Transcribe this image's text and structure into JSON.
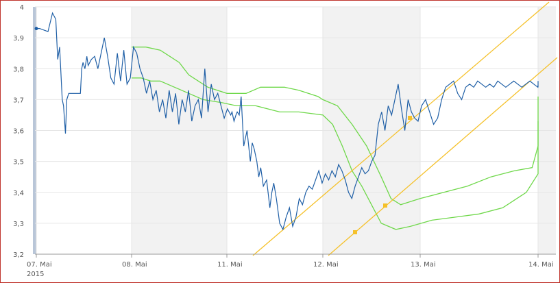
{
  "chart_data": {
    "type": "line",
    "x_tick_labels": [
      "07. Mai",
      "08. Mai",
      "11. Mai",
      "12. Mai",
      "13. Mai",
      "14. Mai"
    ],
    "year_label": "2015",
    "y_tick_labels": [
      "3,2",
      "3,3",
      "3,4",
      "3,5",
      "3,6",
      "3,7",
      "3,8",
      "3,9",
      "4"
    ],
    "ylim": [
      3.2,
      4.0
    ],
    "grid": true,
    "colors": {
      "price": "#1f5fa6",
      "band": "#6fd84a",
      "trendline": "#f5c12a",
      "shaded_day": "#f2f2f2",
      "grid": "#e6e6e6",
      "axis_text": "#555555"
    },
    "series": [
      {
        "role": "price",
        "x": [
          0,
          0.08,
          0.13,
          0.2,
          0.25,
          0.3,
          0.35,
          0.37,
          0.4,
          0.42,
          0.44,
          0.46,
          0.48,
          0.5,
          0.55,
          0.6,
          0.65,
          0.68,
          0.7,
          0.72,
          0.75,
          0.78,
          0.8,
          0.83,
          0.85,
          0.88,
          0.9,
          0.92,
          0.95,
          1,
          1.05,
          1.08,
          1.12,
          1.15,
          1.18,
          1.2,
          1.25,
          1.3,
          1.35,
          1.4,
          1.45,
          1.5,
          1.55,
          1.6,
          1.65,
          1.7,
          1.75,
          1.8,
          1.85,
          1.9,
          1.95,
          2,
          2.05,
          2.08,
          2.1,
          2.15,
          2.2,
          2.25,
          2.3,
          2.35,
          2.4,
          2.45,
          2.5,
          2.55,
          2.6,
          2.65,
          2.7,
          2.75,
          2.8,
          2.85,
          2.9,
          2.95,
          3,
          3.02,
          3.05,
          3.08,
          3.1,
          3.12,
          3.15,
          3.18,
          3.2,
          3.25,
          3.28,
          3.3,
          3.35,
          3.4,
          3.45,
          3.5,
          3.55,
          3.6,
          3.65,
          3.7,
          3.75,
          3.8,
          3.85,
          3.88,
          3.9,
          3.95,
          4,
          4.05,
          4.1,
          4.15,
          4.2,
          4.25,
          4.28,
          4.3,
          4.35,
          4.4,
          4.45,
          4.5,
          4.55,
          4.6,
          4.65,
          4.7,
          4.72,
          4.75,
          4.78,
          4.8,
          4.85,
          4.88,
          4.9,
          4.92,
          4.95
        ],
        "y": [
          3.93,
          3.93,
          3.93,
          3.92,
          3.98,
          3.97,
          3.82,
          3.87,
          3.7,
          3.68,
          3.62,
          3.59,
          3.68,
          3.72,
          3.72,
          3.72,
          3.8,
          3.8,
          3.83,
          3.8,
          3.82,
          3.84,
          3.81,
          3.83,
          3.84,
          3.86,
          3.88,
          3.9,
          3.84,
          3.8,
          3.77,
          3.76,
          3.8,
          3.85,
          3.76,
          3.76,
          3.79,
          3.85,
          3.82,
          3.87,
          3.83,
          3.84,
          3.8,
          3.76,
          3.74,
          3.7,
          3.76,
          3.72,
          3.74,
          3.66,
          3.7,
          3.64,
          3.66,
          3.7,
          3.67,
          3.66,
          3.72,
          3.67,
          3.68,
          3.65,
          3.7,
          3.73,
          3.66,
          3.62,
          3.64,
          3.63,
          3.7,
          3.8,
          3.68,
          3.71,
          3.75,
          3.72,
          3.67,
          3.64,
          3.68,
          3.64,
          3.62,
          3.65,
          3.64,
          3.65,
          3.66,
          3.65,
          3.71,
          3.62,
          3.55,
          3.58,
          3.5,
          3.53,
          3.5,
          3.45,
          3.42,
          3.46,
          3.4,
          3.35,
          3.38,
          3.4,
          3.43,
          3.4,
          3.36,
          3.3,
          3.28,
          3.3,
          3.35,
          3.3,
          3.32,
          3.38,
          3.36,
          3.4,
          3.42,
          3.41,
          3.44,
          3.47,
          3.42,
          3.46,
          3.44,
          3.45,
          3.48,
          3.45,
          3.49,
          3.47,
          3.48,
          3.5,
          3.46
        ]
      },
      {
        "role": "price-continued",
        "x": [
          4.95,
          5,
          5.05,
          5.1,
          5.15,
          5.2,
          5.25,
          5.3,
          5.35,
          5.4,
          5.45,
          5.5,
          5.55,
          5.6,
          5.65,
          5.7,
          5.75,
          5.8,
          5.85,
          5.9,
          5.95,
          6,
          6.05,
          6.1,
          6.15,
          6.2,
          6.25,
          6.3,
          6.35,
          6.4,
          6.45,
          6.5,
          6.55,
          6.6,
          6.65,
          6.7,
          6.75,
          6.8,
          6.85,
          6.9,
          6.95,
          7,
          7.05,
          7.1,
          7.15,
          7.2,
          7.25,
          7.3,
          7.35,
          7.4,
          7.45,
          7.5,
          7.55,
          7.6,
          7.65,
          7.7,
          7.75,
          7.8,
          7.85,
          7.9,
          7.95,
          8,
          8.05
        ],
        "y": [
          3.46,
          3.47,
          3.47,
          3.49,
          3.52,
          3.55,
          3.6,
          3.66,
          3.62,
          3.65,
          3.67,
          3.6,
          3.7,
          3.75,
          3.68,
          3.66,
          3.7,
          3.74,
          3.72,
          3.76,
          3.73,
          3.66,
          3.6,
          3.64,
          3.62,
          3.64,
          3.66,
          3.68,
          3.7,
          3.68,
          3.66,
          3.7,
          3.74,
          3.72,
          3.76,
          3.74,
          3.72,
          3.76,
          3.75,
          3.74,
          3.72,
          3.73,
          3.75,
          3.76,
          3.74,
          3.75,
          3.76,
          3.75,
          3.74,
          3.75,
          3.76,
          3.75,
          3.74,
          3.75,
          3.76,
          3.75,
          3.74,
          3.75,
          3.74,
          3.75,
          3.76,
          3.75,
          3.76
        ]
      }
    ],
    "price_line": {
      "x": [
        0,
        0.05,
        0.18,
        0.25,
        0.3,
        0.33,
        0.36,
        0.4,
        0.42,
        0.45,
        0.47,
        0.5,
        0.55,
        0.68,
        0.7,
        0.72,
        0.75,
        0.78,
        0.8,
        0.85,
        0.9,
        0.95,
        1.0,
        1.05,
        1.1,
        1.15,
        1.2,
        1.25,
        1.3,
        1.35,
        1.4,
        1.45,
        1.5,
        1.55,
        1.6,
        1.65,
        1.7,
        1.75,
        1.8,
        1.85,
        1.9,
        1.95,
        2.0,
        2.05,
        2.1,
        2.15,
        2.2,
        2.25,
        2.3,
        2.35,
        2.4,
        2.45,
        2.5,
        2.55,
        2.6,
        2.65,
        2.7,
        2.75,
        2.8,
        2.85,
        2.9,
        2.95,
        3.0,
        3.02,
        3.05,
        3.08,
        3.1,
        3.13,
        3.16,
        3.2,
        3.25,
        3.3,
        3.33,
        3.36,
        3.4,
        3.43,
        3.46,
        3.5,
        3.55,
        3.6,
        3.63,
        3.66,
        3.7,
        3.75,
        3.8,
        3.85,
        3.9,
        3.95,
        4.0,
        4.05,
        4.1,
        4.15,
        4.2,
        4.25,
        4.3,
        4.35,
        4.4,
        4.45,
        4.5,
        4.55,
        4.6,
        4.65,
        4.7,
        4.75,
        4.8,
        4.85,
        4.9,
        4.95,
        5.0,
        5.05,
        5.1,
        5.15,
        5.2,
        5.25,
        5.3,
        5.35,
        5.4,
        5.45,
        5.5,
        5.55,
        5.6,
        5.65,
        5.7,
        5.75,
        5.8,
        5.85,
        5.9,
        5.95,
        6.0,
        6.05,
        6.1,
        6.15,
        6.2,
        6.25,
        6.3,
        6.35,
        6.4,
        6.45,
        6.5,
        6.55,
        6.6,
        6.65,
        6.7,
        6.75,
        6.8,
        6.85,
        6.9,
        6.95,
        7.0,
        7.05,
        7.1,
        7.15,
        7.2,
        7.25,
        7.3,
        7.35,
        7.4,
        7.45,
        7.5,
        7.55,
        7.6,
        7.65,
        7.7,
        7.75,
        7.8,
        7.85,
        7.9,
        7.95,
        8.0,
        8.05,
        8.1,
        8.15,
        8.2,
        8.25,
        8.3,
        8.35,
        8.4,
        8.45,
        8.5,
        8.55
      ],
      "y": [
        3.93,
        3.93,
        3.92,
        3.98,
        3.96,
        3.83,
        3.87,
        3.7,
        3.68,
        3.59,
        3.7,
        3.72,
        3.72,
        3.72,
        3.8,
        3.82,
        3.8,
        3.84,
        3.81,
        3.83,
        3.84,
        3.8,
        3.85,
        3.9,
        3.84,
        3.77,
        3.75,
        3.85,
        3.76,
        3.86,
        3.75,
        3.77,
        3.87,
        3.85,
        3.8,
        3.77,
        3.72,
        3.76,
        3.7,
        3.73,
        3.66,
        3.7,
        3.64,
        3.73,
        3.66,
        3.72,
        3.62,
        3.7,
        3.66,
        3.73,
        3.63,
        3.68,
        3.7,
        3.64,
        3.8,
        3.66,
        3.75,
        3.7,
        3.72,
        3.68,
        3.64,
        3.67,
        3.65,
        3.66,
        3.63,
        3.65,
        3.66,
        3.65,
        3.71,
        3.55,
        3.6,
        3.5,
        3.56,
        3.54,
        3.5,
        3.45,
        3.48,
        3.42,
        3.44,
        3.35,
        3.4,
        3.43,
        3.38,
        3.3,
        3.28,
        3.32,
        3.35,
        3.29,
        3.32,
        3.38,
        3.36,
        3.4,
        3.42,
        3.41,
        3.44,
        3.47,
        3.43,
        3.46,
        3.44,
        3.47,
        3.45,
        3.49,
        3.47,
        3.44,
        3.4,
        3.38,
        3.42,
        3.45,
        3.48,
        3.46,
        3.47,
        3.5,
        3.52,
        3.62,
        3.66,
        3.6,
        3.68,
        3.65,
        3.7,
        3.75,
        3.67,
        3.6,
        3.7,
        3.66,
        3.64,
        3.63,
        3.68,
        3.7,
        3.66,
        3.62,
        3.64,
        3.7,
        3.74,
        3.75,
        3.76,
        3.72,
        3.7,
        3.74,
        3.75,
        3.74,
        3.76,
        3.75,
        3.74,
        3.75,
        3.74,
        3.76,
        3.75,
        3.74,
        3.75,
        3.76,
        3.75,
        3.74,
        3.75,
        3.76,
        3.75,
        3.74,
        3.75,
        3.76,
        3.75,
        3.74,
        3.75,
        3.76,
        3.75,
        3.74,
        3.75,
        3.76,
        3.75,
        3.74,
        3.75,
        3.76,
        3.75,
        3.74,
        3.75,
        3.76,
        3.75,
        3.74,
        3.75,
        3.76,
        3.75,
        3.74,
        3.75,
        3.76
      ]
    }
  }
}
